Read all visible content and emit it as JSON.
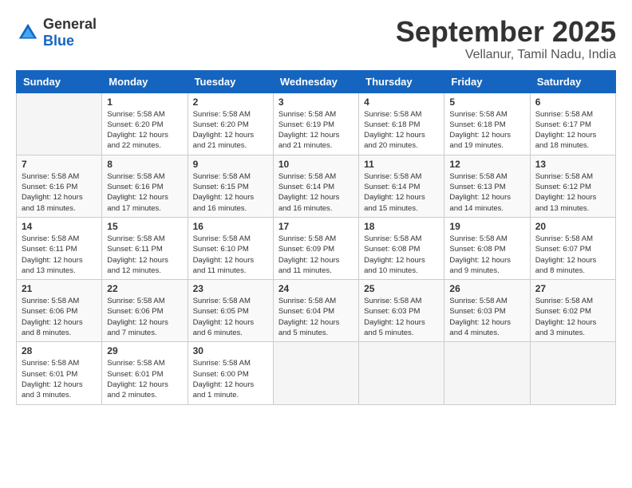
{
  "logo": {
    "general": "General",
    "blue": "Blue"
  },
  "header": {
    "month": "September 2025",
    "location": "Vellanur, Tamil Nadu, India"
  },
  "days_of_week": [
    "Sunday",
    "Monday",
    "Tuesday",
    "Wednesday",
    "Thursday",
    "Friday",
    "Saturday"
  ],
  "weeks": [
    [
      {
        "day": "",
        "sunrise": "",
        "sunset": "",
        "daylight": ""
      },
      {
        "day": "1",
        "sunrise": "Sunrise: 5:58 AM",
        "sunset": "Sunset: 6:20 PM",
        "daylight": "Daylight: 12 hours and 22 minutes."
      },
      {
        "day": "2",
        "sunrise": "Sunrise: 5:58 AM",
        "sunset": "Sunset: 6:20 PM",
        "daylight": "Daylight: 12 hours and 21 minutes."
      },
      {
        "day": "3",
        "sunrise": "Sunrise: 5:58 AM",
        "sunset": "Sunset: 6:19 PM",
        "daylight": "Daylight: 12 hours and 21 minutes."
      },
      {
        "day": "4",
        "sunrise": "Sunrise: 5:58 AM",
        "sunset": "Sunset: 6:18 PM",
        "daylight": "Daylight: 12 hours and 20 minutes."
      },
      {
        "day": "5",
        "sunrise": "Sunrise: 5:58 AM",
        "sunset": "Sunset: 6:18 PM",
        "daylight": "Daylight: 12 hours and 19 minutes."
      },
      {
        "day": "6",
        "sunrise": "Sunrise: 5:58 AM",
        "sunset": "Sunset: 6:17 PM",
        "daylight": "Daylight: 12 hours and 18 minutes."
      }
    ],
    [
      {
        "day": "7",
        "sunrise": "Sunrise: 5:58 AM",
        "sunset": "Sunset: 6:16 PM",
        "daylight": "Daylight: 12 hours and 18 minutes."
      },
      {
        "day": "8",
        "sunrise": "Sunrise: 5:58 AM",
        "sunset": "Sunset: 6:16 PM",
        "daylight": "Daylight: 12 hours and 17 minutes."
      },
      {
        "day": "9",
        "sunrise": "Sunrise: 5:58 AM",
        "sunset": "Sunset: 6:15 PM",
        "daylight": "Daylight: 12 hours and 16 minutes."
      },
      {
        "day": "10",
        "sunrise": "Sunrise: 5:58 AM",
        "sunset": "Sunset: 6:14 PM",
        "daylight": "Daylight: 12 hours and 16 minutes."
      },
      {
        "day": "11",
        "sunrise": "Sunrise: 5:58 AM",
        "sunset": "Sunset: 6:14 PM",
        "daylight": "Daylight: 12 hours and 15 minutes."
      },
      {
        "day": "12",
        "sunrise": "Sunrise: 5:58 AM",
        "sunset": "Sunset: 6:13 PM",
        "daylight": "Daylight: 12 hours and 14 minutes."
      },
      {
        "day": "13",
        "sunrise": "Sunrise: 5:58 AM",
        "sunset": "Sunset: 6:12 PM",
        "daylight": "Daylight: 12 hours and 13 minutes."
      }
    ],
    [
      {
        "day": "14",
        "sunrise": "Sunrise: 5:58 AM",
        "sunset": "Sunset: 6:11 PM",
        "daylight": "Daylight: 12 hours and 13 minutes."
      },
      {
        "day": "15",
        "sunrise": "Sunrise: 5:58 AM",
        "sunset": "Sunset: 6:11 PM",
        "daylight": "Daylight: 12 hours and 12 minutes."
      },
      {
        "day": "16",
        "sunrise": "Sunrise: 5:58 AM",
        "sunset": "Sunset: 6:10 PM",
        "daylight": "Daylight: 12 hours and 11 minutes."
      },
      {
        "day": "17",
        "sunrise": "Sunrise: 5:58 AM",
        "sunset": "Sunset: 6:09 PM",
        "daylight": "Daylight: 12 hours and 11 minutes."
      },
      {
        "day": "18",
        "sunrise": "Sunrise: 5:58 AM",
        "sunset": "Sunset: 6:08 PM",
        "daylight": "Daylight: 12 hours and 10 minutes."
      },
      {
        "day": "19",
        "sunrise": "Sunrise: 5:58 AM",
        "sunset": "Sunset: 6:08 PM",
        "daylight": "Daylight: 12 hours and 9 minutes."
      },
      {
        "day": "20",
        "sunrise": "Sunrise: 5:58 AM",
        "sunset": "Sunset: 6:07 PM",
        "daylight": "Daylight: 12 hours and 8 minutes."
      }
    ],
    [
      {
        "day": "21",
        "sunrise": "Sunrise: 5:58 AM",
        "sunset": "Sunset: 6:06 PM",
        "daylight": "Daylight: 12 hours and 8 minutes."
      },
      {
        "day": "22",
        "sunrise": "Sunrise: 5:58 AM",
        "sunset": "Sunset: 6:06 PM",
        "daylight": "Daylight: 12 hours and 7 minutes."
      },
      {
        "day": "23",
        "sunrise": "Sunrise: 5:58 AM",
        "sunset": "Sunset: 6:05 PM",
        "daylight": "Daylight: 12 hours and 6 minutes."
      },
      {
        "day": "24",
        "sunrise": "Sunrise: 5:58 AM",
        "sunset": "Sunset: 6:04 PM",
        "daylight": "Daylight: 12 hours and 5 minutes."
      },
      {
        "day": "25",
        "sunrise": "Sunrise: 5:58 AM",
        "sunset": "Sunset: 6:03 PM",
        "daylight": "Daylight: 12 hours and 5 minutes."
      },
      {
        "day": "26",
        "sunrise": "Sunrise: 5:58 AM",
        "sunset": "Sunset: 6:03 PM",
        "daylight": "Daylight: 12 hours and 4 minutes."
      },
      {
        "day": "27",
        "sunrise": "Sunrise: 5:58 AM",
        "sunset": "Sunset: 6:02 PM",
        "daylight": "Daylight: 12 hours and 3 minutes."
      }
    ],
    [
      {
        "day": "28",
        "sunrise": "Sunrise: 5:58 AM",
        "sunset": "Sunset: 6:01 PM",
        "daylight": "Daylight: 12 hours and 3 minutes."
      },
      {
        "day": "29",
        "sunrise": "Sunrise: 5:58 AM",
        "sunset": "Sunset: 6:01 PM",
        "daylight": "Daylight: 12 hours and 2 minutes."
      },
      {
        "day": "30",
        "sunrise": "Sunrise: 5:58 AM",
        "sunset": "Sunset: 6:00 PM",
        "daylight": "Daylight: 12 hours and 1 minute."
      },
      {
        "day": "",
        "sunrise": "",
        "sunset": "",
        "daylight": ""
      },
      {
        "day": "",
        "sunrise": "",
        "sunset": "",
        "daylight": ""
      },
      {
        "day": "",
        "sunrise": "",
        "sunset": "",
        "daylight": ""
      },
      {
        "day": "",
        "sunrise": "",
        "sunset": "",
        "daylight": ""
      }
    ]
  ]
}
